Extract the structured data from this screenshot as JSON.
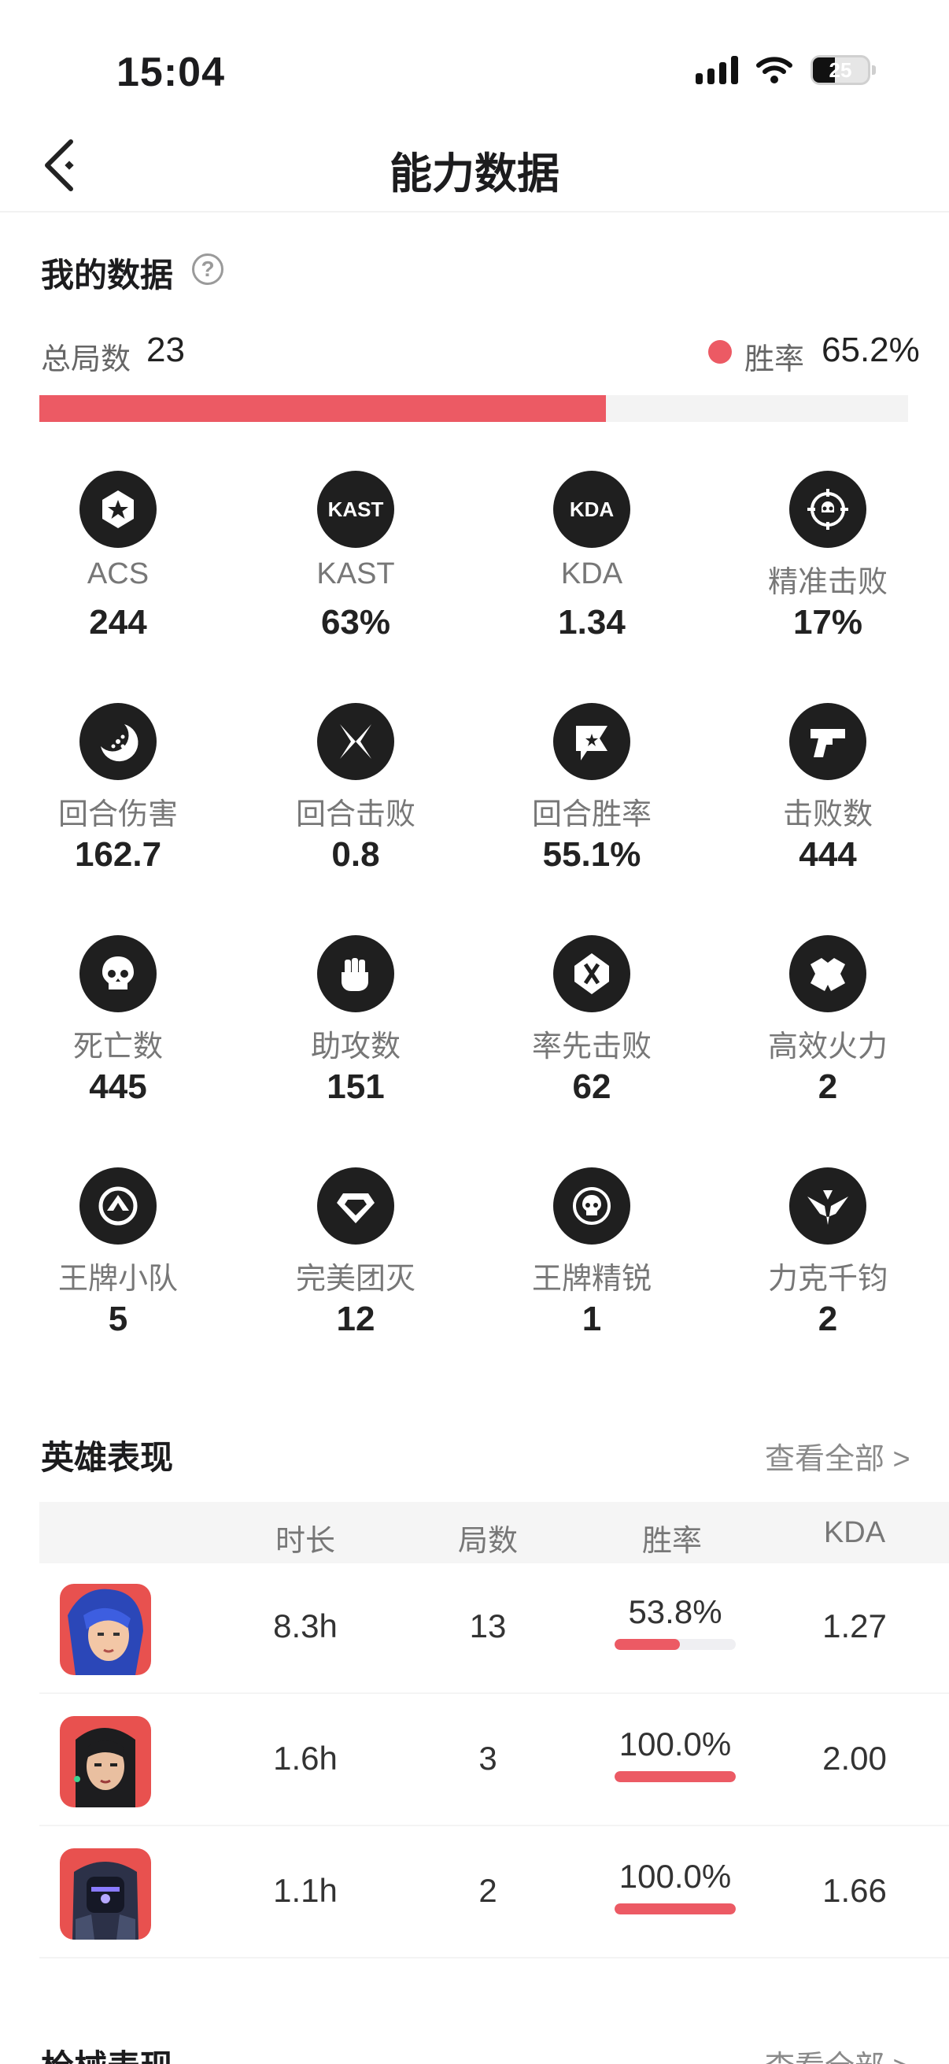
{
  "status_bar": {
    "time": "15:04",
    "battery": "25"
  },
  "nav": {
    "title": "能力数据"
  },
  "my_data": {
    "title": "我的数据",
    "help": "?",
    "total_games_label": "总局数",
    "total_games": "23",
    "win_rate_label": "胜率",
    "win_rate": "65.2%",
    "win_rate_fraction": 0.652,
    "stats": [
      {
        "label": "ACS",
        "value": "244",
        "icon": "star-badge-icon"
      },
      {
        "label": "KAST",
        "value": "63%",
        "icon": "kast-icon",
        "icon_text": "KAST"
      },
      {
        "label": "KDA",
        "value": "1.34",
        "icon": "kda-icon",
        "icon_text": "KDA"
      },
      {
        "label": "精准击败",
        "value": "17%",
        "icon": "crosshair-skull-icon"
      },
      {
        "label": "回合伤害",
        "value": "162.7",
        "icon": "damage-icon"
      },
      {
        "label": "回合击败",
        "value": "0.8",
        "icon": "crossed-blades-icon"
      },
      {
        "label": "回合胜率",
        "value": "55.1%",
        "icon": "flag-icon"
      },
      {
        "label": "击败数",
        "value": "444",
        "icon": "pistol-icon"
      },
      {
        "label": "死亡数",
        "value": "445",
        "icon": "skull-icon"
      },
      {
        "label": "助攻数",
        "value": "151",
        "icon": "fist-icon"
      },
      {
        "label": "率先击败",
        "value": "62",
        "icon": "first-blood-icon"
      },
      {
        "label": "高效火力",
        "value": "2",
        "icon": "shield-burst-icon"
      },
      {
        "label": "王牌小队",
        "value": "5",
        "icon": "ace-team-icon"
      },
      {
        "label": "完美团灭",
        "value": "12",
        "icon": "diamond-icon"
      },
      {
        "label": "王牌精锐",
        "value": "1",
        "icon": "elite-skull-icon"
      },
      {
        "label": "力克千钧",
        "value": "2",
        "icon": "wings-icon"
      }
    ]
  },
  "heroes": {
    "title": "英雄表现",
    "see_all": "查看全部 >",
    "columns": [
      "时长",
      "局数",
      "胜率",
      "KDA"
    ],
    "rows": [
      {
        "avatar": "hero-blue-hair-avatar",
        "duration": "8.3h",
        "games": "13",
        "win_rate": "53.8%",
        "win_fraction": 0.538,
        "kda": "1.27"
      },
      {
        "avatar": "hero-dark-hair-avatar",
        "duration": "1.6h",
        "games": "3",
        "win_rate": "100.0%",
        "win_fraction": 1.0,
        "kda": "2.00"
      },
      {
        "avatar": "hero-robot-avatar",
        "duration": "1.1h",
        "games": "2",
        "win_rate": "100.0%",
        "win_fraction": 1.0,
        "kda": "1.66"
      }
    ]
  },
  "weapons": {
    "title": "枪械表现",
    "see_all": "查看全部 >"
  },
  "colors": {
    "accent": "#ec5a64",
    "icon_bg": "#1f1f1f"
  }
}
